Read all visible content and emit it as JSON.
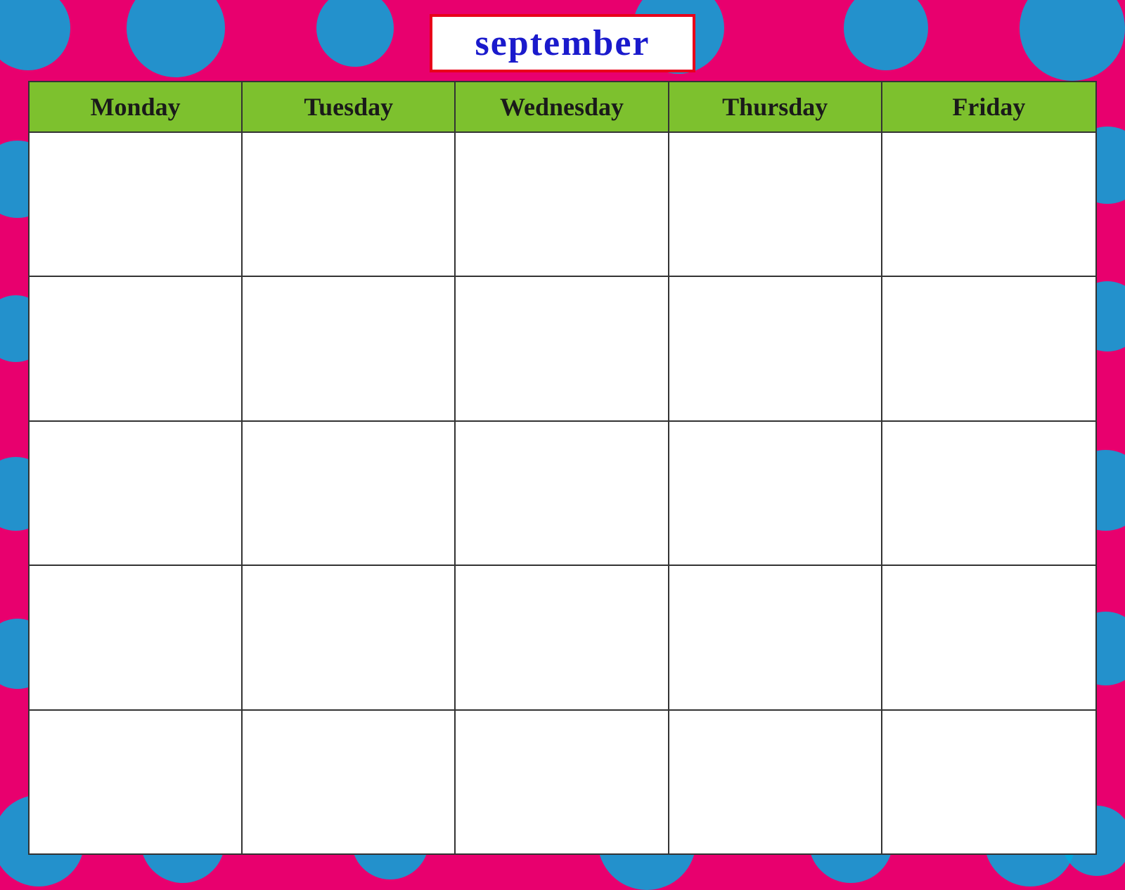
{
  "background": {
    "color": "#e8006e",
    "dot_color": "#00aadd"
  },
  "title": {
    "text": "september",
    "border_color": "#e8001a",
    "text_color": "#1a1acc"
  },
  "calendar": {
    "header_bg": "#7dc12e",
    "days": [
      {
        "label": "Monday"
      },
      {
        "label": "Tuesday"
      },
      {
        "label": "Wednesday"
      },
      {
        "label": "Thursday"
      },
      {
        "label": "Friday"
      }
    ],
    "rows": 5
  }
}
